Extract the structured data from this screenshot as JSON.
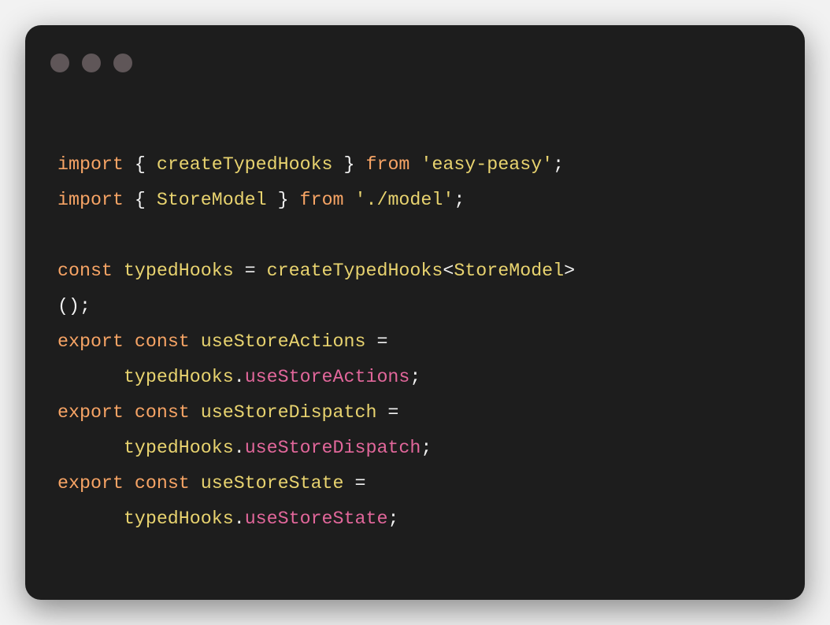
{
  "window": {
    "controls": [
      "close-dot",
      "minimize-dot",
      "maximize-dot"
    ],
    "colors": {
      "background": "#1d1d1d",
      "dot": "#5f5658",
      "keyword": "#f7a465",
      "identifier": "#e8d36f",
      "property": "#e2679b",
      "punctuation": "#f2f2f2"
    }
  },
  "code": {
    "lines": [
      [
        [
          "import",
          "kw"
        ],
        [
          " { ",
          "punc"
        ],
        [
          "createTypedHooks",
          "id"
        ],
        [
          " } ",
          "punc"
        ],
        [
          "from",
          "kw"
        ],
        [
          " ",
          "punc"
        ],
        [
          "'easy-peasy'",
          "str"
        ],
        [
          ";",
          "punc"
        ]
      ],
      [
        [
          "import",
          "kw"
        ],
        [
          " { ",
          "punc"
        ],
        [
          "StoreModel",
          "id"
        ],
        [
          " } ",
          "punc"
        ],
        [
          "from",
          "kw"
        ],
        [
          " ",
          "punc"
        ],
        [
          "'./model'",
          "str"
        ],
        [
          ";",
          "punc"
        ]
      ],
      [],
      [
        [
          "const",
          "kw"
        ],
        [
          " ",
          "punc"
        ],
        [
          "typedHooks",
          "id"
        ],
        [
          " = ",
          "punc"
        ],
        [
          "createTypedHooks",
          "id"
        ],
        [
          "<",
          "punc"
        ],
        [
          "StoreModel",
          "id"
        ],
        [
          ">",
          "punc"
        ]
      ],
      [
        [
          "();",
          "punc"
        ]
      ],
      [
        [
          "export",
          "kw"
        ],
        [
          " ",
          "punc"
        ],
        [
          "const",
          "kw"
        ],
        [
          " ",
          "punc"
        ],
        [
          "useStoreActions",
          "id"
        ],
        [
          " =",
          "punc"
        ]
      ],
      [
        [
          "      ",
          "punc"
        ],
        [
          "typedHooks",
          "id"
        ],
        [
          ".",
          "punc"
        ],
        [
          "useStoreActions",
          "prop"
        ],
        [
          ";",
          "punc"
        ]
      ],
      [
        [
          "export",
          "kw"
        ],
        [
          " ",
          "punc"
        ],
        [
          "const",
          "kw"
        ],
        [
          " ",
          "punc"
        ],
        [
          "useStoreDispatch",
          "id"
        ],
        [
          " =",
          "punc"
        ]
      ],
      [
        [
          "      ",
          "punc"
        ],
        [
          "typedHooks",
          "id"
        ],
        [
          ".",
          "punc"
        ],
        [
          "useStoreDispatch",
          "prop"
        ],
        [
          ";",
          "punc"
        ]
      ],
      [
        [
          "export",
          "kw"
        ],
        [
          " ",
          "punc"
        ],
        [
          "const",
          "kw"
        ],
        [
          " ",
          "punc"
        ],
        [
          "useStoreState",
          "id"
        ],
        [
          " =",
          "punc"
        ]
      ],
      [
        [
          "      ",
          "punc"
        ],
        [
          "typedHooks",
          "id"
        ],
        [
          ".",
          "punc"
        ],
        [
          "useStoreState",
          "prop"
        ],
        [
          ";",
          "punc"
        ]
      ]
    ]
  }
}
